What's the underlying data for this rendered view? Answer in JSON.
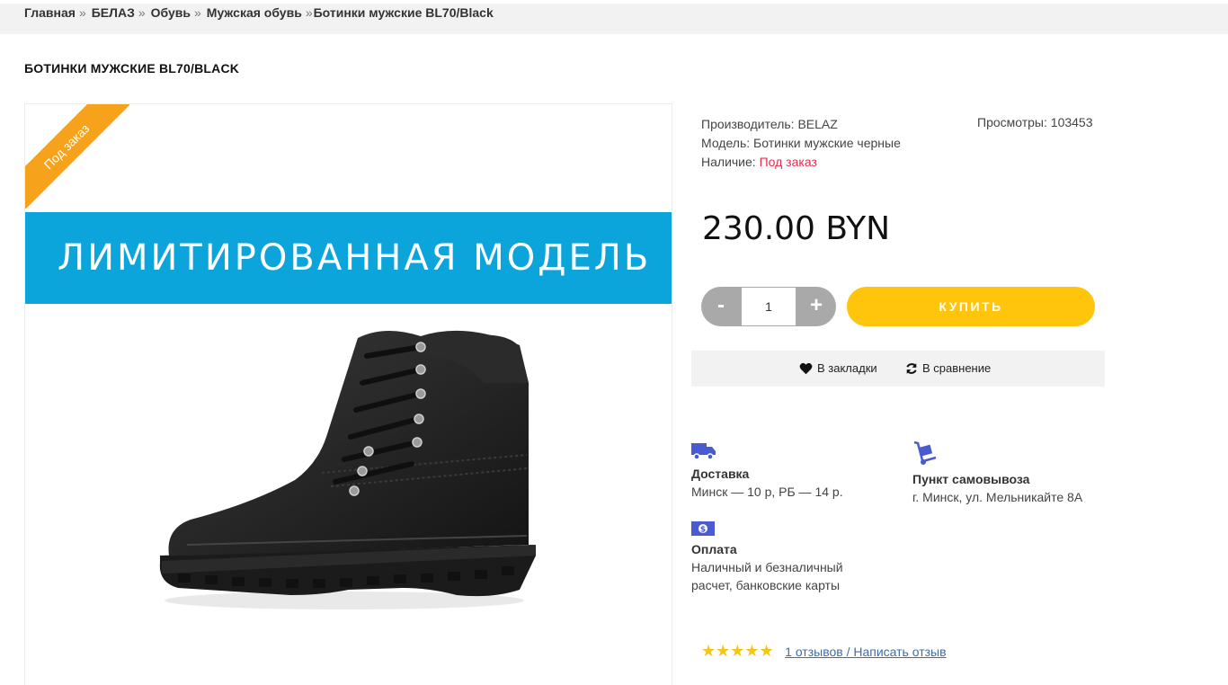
{
  "breadcrumb": {
    "items": [
      "Главная",
      "БЕЛАЗ",
      "Обувь",
      "Мужская обувь",
      "Ботинки мужские BL70/Black"
    ],
    "separator": "»"
  },
  "product": {
    "title": "БОТИНКИ МУЖСКИЕ BL70/BLACK",
    "ribbon": "Под заказ",
    "banner": "ЛИМИТИРОВАННАЯ  МОДЕЛЬ",
    "manufacturer_label": "Производитель:",
    "manufacturer_value": "BELAZ",
    "model_label": "Модель:",
    "model_value": "Ботинки мужские черные",
    "availability_label": "Наличие:",
    "availability_value": "Под заказ",
    "views_label": "Просмотры:",
    "views_value": "103453",
    "price": "230.00 BYN"
  },
  "purchase": {
    "minus": "-",
    "plus": "+",
    "quantity": "1",
    "buy_label": "КУПИТЬ"
  },
  "actions": {
    "bookmark": "В закладки",
    "compare": "В сравнение"
  },
  "features": {
    "delivery_title": "Доставка",
    "delivery_text": "Минск — 10 р, РБ — 14 р.",
    "pickup_title": "Пункт самовывоза",
    "pickup_text": "г. Минск, ул. Мельникайте 8А",
    "payment_title": "Оплата",
    "payment_text_1": "Наличный и безналичный",
    "payment_text_2": "расчет, банковские карты"
  },
  "reviews": {
    "rating": 5,
    "stars": "★★★★★",
    "link": "1 отзывов / Написать отзыв"
  },
  "colors": {
    "ribbon": "#f7a21b",
    "banner": "#0ba5dc",
    "buy_button": "#fec50c",
    "availability": "#e52d4e",
    "icons": "#4a5bd1",
    "stars": "#f5c518"
  }
}
